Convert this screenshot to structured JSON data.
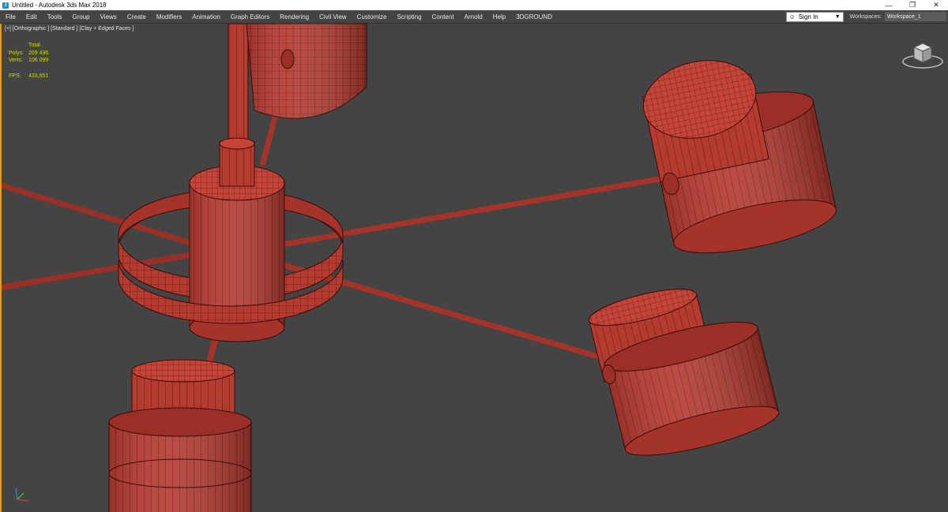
{
  "window": {
    "title": "Untitled - Autodesk 3ds Max 2018"
  },
  "menu": {
    "items": [
      "File",
      "Edit",
      "Tools",
      "Group",
      "Views",
      "Create",
      "Modifiers",
      "Animation",
      "Graph Editors",
      "Rendering",
      "Civil View",
      "Customize",
      "Scripting",
      "Content",
      "Arnold",
      "Help",
      "3DGROUND"
    ],
    "signin_label": "Sign In",
    "workspaces_label": "Workspaces:",
    "workspace_value": "Workspace_1"
  },
  "viewport": {
    "label": "[+] [Orthographic ] [Standard ] [Clay + Edged Faces ]",
    "stats": {
      "header": "Total",
      "polys_label": "Polys:",
      "polys_value": "209 436",
      "verts_label": "Verts:",
      "verts_value": "106 099",
      "fps_label": "FPS:",
      "fps_value": "433,651"
    }
  },
  "colors": {
    "background": "#444444",
    "clay": "#b53a30",
    "stats_text": "#d8d800",
    "active_viewport_border": "#e0a000"
  }
}
